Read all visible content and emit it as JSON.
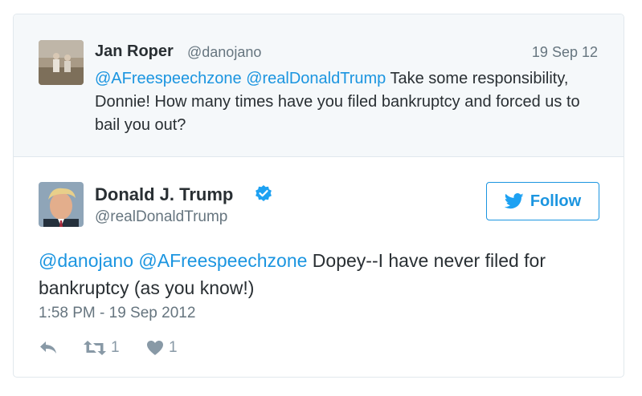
{
  "reply_to": {
    "name": "Jan Roper",
    "handle": "@danojano",
    "date": "19 Sep 12",
    "mention1": "@AFreespeechzone",
    "mention2": "@realDonaldTrump",
    "text": " Take some responsibility, Donnie! How many times have you filed bankruptcy and forced us to bail you out?"
  },
  "tweet": {
    "name": "Donald J. Trump",
    "handle": "@realDonaldTrump",
    "follow_label": "Follow",
    "mention1": "@danojano",
    "mention2": "@AFreespeechzone",
    "text": " Dopey--I have never filed for bankruptcy (as you know!)",
    "timestamp": "1:58 PM - 19 Sep 2012",
    "retweet_count": "1",
    "like_count": "1"
  },
  "colors": {
    "link": "#1b95e0",
    "muted": "#66757f",
    "text": "#292f33",
    "reply_bg": "#f5f8fa"
  },
  "icons": [
    "reply-icon",
    "retweet-icon",
    "heart-icon",
    "twitter-bird-icon",
    "verified-badge-icon"
  ]
}
